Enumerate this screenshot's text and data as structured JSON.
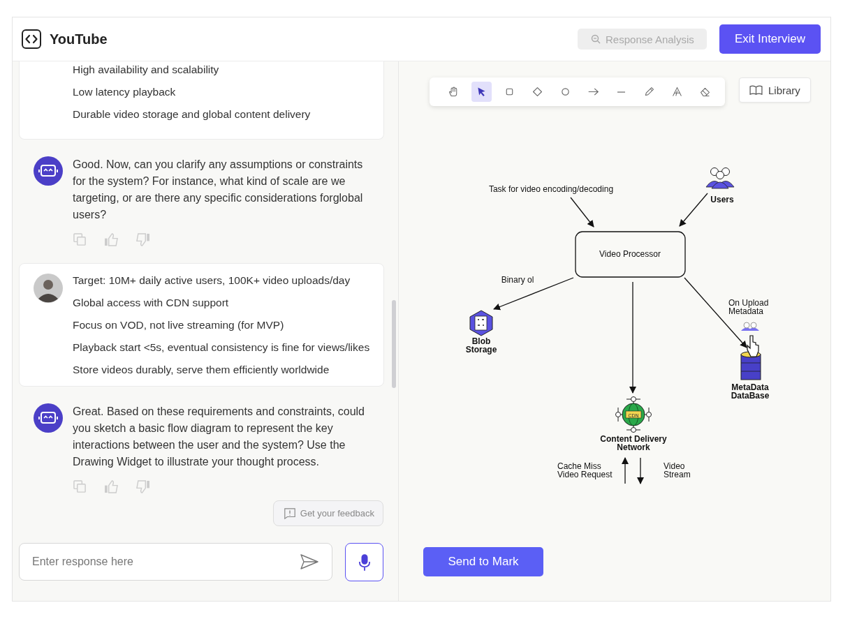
{
  "header": {
    "title": "YouTube",
    "analysis_button": {
      "label": "Response Analysis",
      "disabled": true
    },
    "exit_button": "Exit Interview"
  },
  "messages": [
    {
      "kind": "user",
      "lines": [
        "High availability and scalability",
        "Low latency playback",
        "Durable video storage and global content delivery"
      ]
    },
    {
      "kind": "bot",
      "text": "Good. Now, can you clarify any assumptions or constraints for the system? For instance, what kind of scale are we targeting, or are there any specific considerations forglobal users?"
    },
    {
      "kind": "user",
      "avatar": true,
      "lines": [
        "Target: 10M+ daily active users, 100K+ video uploads/day",
        "Global access with CDN support",
        "Focus on VOD, not live streaming (for MVP)",
        "Playback start <5s, eventual consistency is fine for views/likes",
        "Store videos durably, serve them efficiently worldwide"
      ]
    },
    {
      "kind": "bot",
      "text": "Great. Based on these requirements and constraints, could you sketch a basic flow diagram to represent the key interactions between the user and the system? Use the Drawing Widget to illustrate your thought process."
    }
  ],
  "feedback_button": "Get your feedback",
  "input": {
    "placeholder": "Enter response here"
  },
  "toolbar": [
    {
      "kind": "hand",
      "selected": false
    },
    {
      "kind": "select",
      "selected": true
    },
    {
      "kind": "rectangle",
      "selected": false
    },
    {
      "kind": "diamond",
      "selected": false
    },
    {
      "kind": "ellipse",
      "selected": false
    },
    {
      "kind": "arrow",
      "selected": false
    },
    {
      "kind": "line",
      "selected": false
    },
    {
      "kind": "pencil",
      "selected": false
    },
    {
      "kind": "text",
      "selected": false
    },
    {
      "kind": "eraser",
      "selected": false
    }
  ],
  "library_button": "Library",
  "diagram": {
    "labels": [
      {
        "kind": "note",
        "lines": [
          "Task for video encoding/decoding"
        ]
      },
      {
        "kind": "users",
        "lines": [
          "Users"
        ]
      },
      {
        "kind": "box",
        "lines": [
          "Video Processor"
        ]
      },
      {
        "kind": "note",
        "lines": [
          "Binary ol"
        ]
      },
      {
        "kind": "blob",
        "lines": [
          "Blob",
          "Storage"
        ]
      },
      {
        "kind": "note",
        "lines": [
          "On Upload",
          "Metadata"
        ]
      },
      {
        "kind": "database",
        "lines": [
          "MetaData",
          "DataBase"
        ]
      },
      {
        "kind": "cdn",
        "lines": [
          "Content Delivery",
          "Network"
        ],
        "badge": "CDN"
      },
      {
        "kind": "note",
        "lines": [
          "Cache Miss",
          "Video Request"
        ]
      },
      {
        "kind": "note",
        "lines": [
          "Video",
          "Stream"
        ]
      }
    ]
  },
  "send_button": "Send to Mark"
}
